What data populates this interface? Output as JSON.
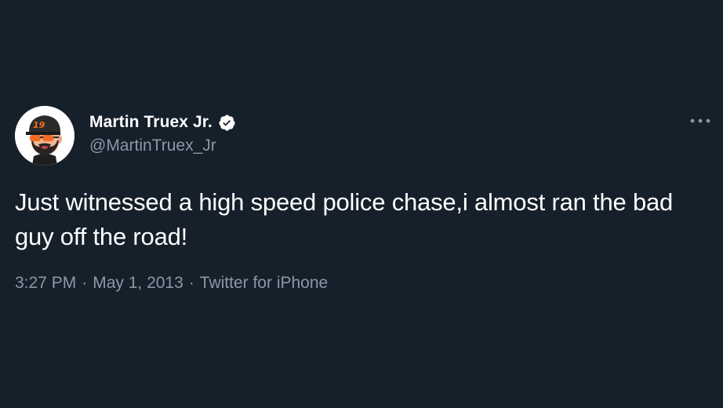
{
  "tweet": {
    "author": {
      "display_name": "Martin Truex Jr.",
      "handle": "@MartinTruex_Jr",
      "verified": true,
      "avatar": {
        "icon": "avatar-illustration",
        "cap_number": "19",
        "cap_color": "#2b2b2b",
        "number_color": "#f26b21",
        "glasses_color": "#f26b21"
      }
    },
    "text": "Just witnessed a high speed police chase,i almost ran the bad guy off the road!",
    "time": "3:27 PM",
    "separator": "·",
    "date": "May 1, 2013",
    "source": "Twitter for iPhone"
  },
  "icons": {
    "verified": "verified-badge-icon",
    "more": "more-options-icon"
  },
  "colors": {
    "background": "#15202b",
    "primary_text": "#ffffff",
    "secondary_text": "#8b98a5"
  }
}
